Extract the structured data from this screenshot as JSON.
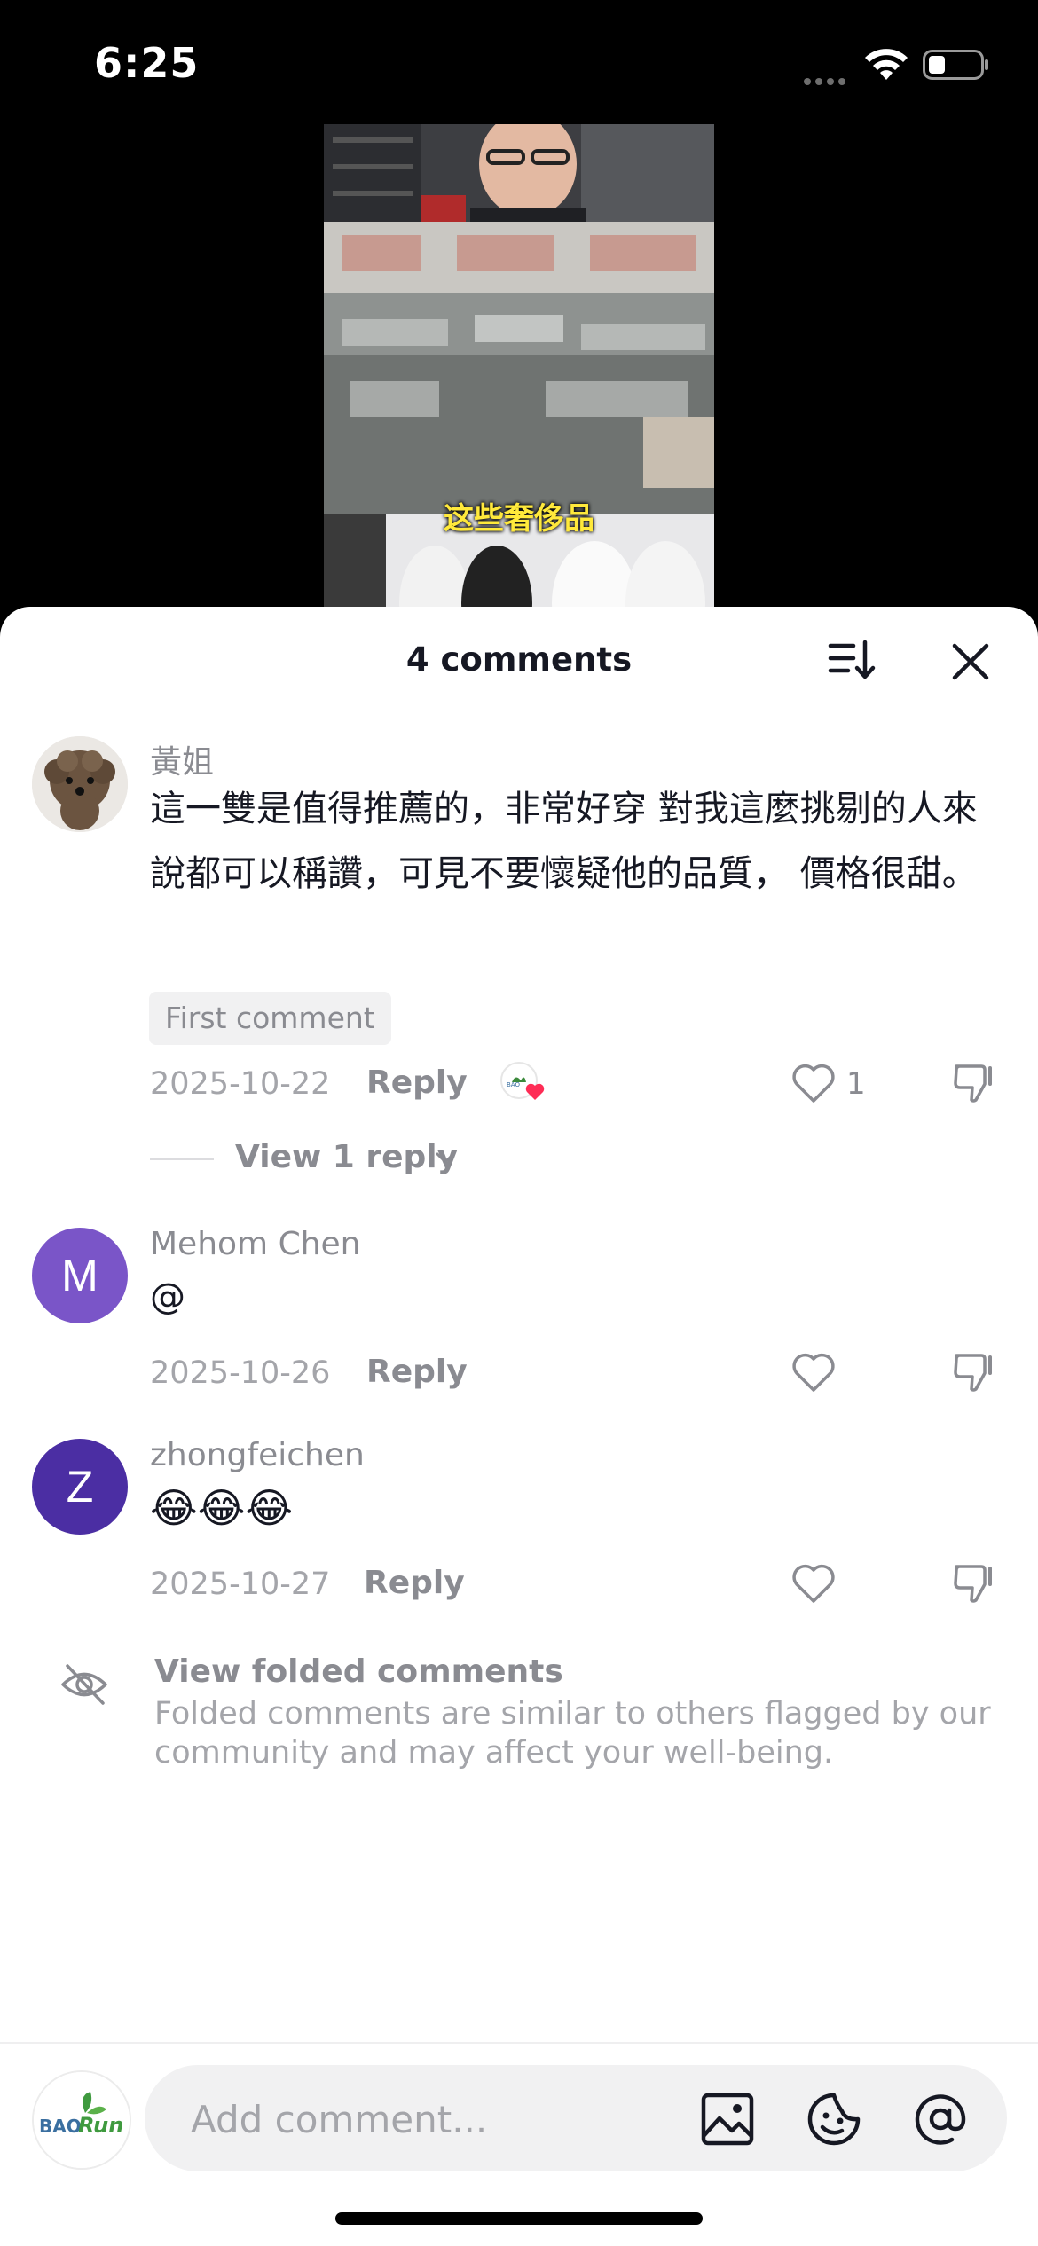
{
  "status_bar": {
    "time": "6:25"
  },
  "video": {
    "caption": "这些奢侈品"
  },
  "sheet": {
    "title": "4 comments"
  },
  "comments": [
    {
      "name": "黃姐",
      "text": "這一雙是值得推薦的，非常好穿 對我這麼挑剔的人來說都可以稱讚，可見不要懷疑他的品質， 價格很甜。",
      "badge": "First comment",
      "date": "2025-10-22",
      "reply_label": "Reply",
      "likes": "1",
      "view_replies": "View 1 reply"
    },
    {
      "name": "Mehom Chen",
      "avatar_letter": "M",
      "avatar_color": "#7a55c8",
      "text": "@",
      "date": "2025-10-26",
      "reply_label": "Reply"
    },
    {
      "name": "zhongfeichen",
      "avatar_letter": "Z",
      "avatar_color": "#4b2ea3",
      "text": "😂😂😂",
      "date": "2025-10-27",
      "reply_label": "Reply"
    }
  ],
  "folded": {
    "title": "View folded comments",
    "description": "Folded comments are similar to others flagged by our community and may affect your well-being."
  },
  "input": {
    "placeholder": "Add comment..."
  },
  "my_avatar": {
    "text_bao": "BAO",
    "text_run": "Run"
  }
}
